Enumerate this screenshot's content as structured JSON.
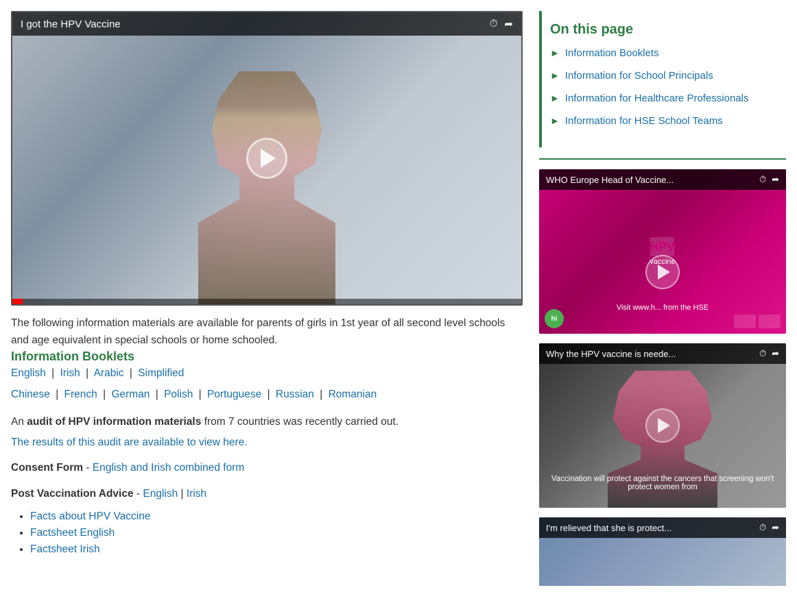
{
  "main_video": {
    "title": "I got the HPV Vaccine",
    "clock_icon": "⏱",
    "share_icon": "➦"
  },
  "description": "The following information materials are available for parents of girls in 1st year of all second level schools and age equivalent in special schools or home schooled.",
  "information_booklets": {
    "heading": "Information Booklets",
    "languages_row1": [
      {
        "label": "English",
        "href": "#"
      },
      {
        "label": "Irish",
        "href": "#"
      },
      {
        "label": "Arabic",
        "href": "#"
      },
      {
        "label": "Simplified",
        "href": "#"
      }
    ],
    "languages_row2": [
      {
        "label": "Chinese",
        "href": "#"
      },
      {
        "label": "French",
        "href": "#"
      },
      {
        "label": "German",
        "href": "#"
      },
      {
        "label": "Polish",
        "href": "#"
      },
      {
        "label": "Portuguese",
        "href": "#"
      },
      {
        "label": "Russian",
        "href": "#"
      },
      {
        "label": "Romanian",
        "href": "#"
      }
    ]
  },
  "audit": {
    "pre_text": "An",
    "bold_text": "audit of HPV information materials",
    "post_text": "from 7 countries was recently carried out.",
    "link_text": "The results of this audit are available to view here."
  },
  "consent_form": {
    "label": "Consent Form",
    "separator": "-",
    "link_text": "English and Irish combined form",
    "link_href": "#"
  },
  "post_vaccination": {
    "label": "Post Vaccination Advice",
    "separator": "-",
    "english_label": "English",
    "irish_label": "Irish",
    "english_href": "#",
    "irish_href": "#"
  },
  "bullet_links": [
    {
      "label": "Facts about HPV Vaccine",
      "href": "#"
    },
    {
      "label": "Factsheet English",
      "href": "#"
    },
    {
      "label": "Factsheet Irish",
      "href": "#"
    }
  ],
  "sidebar": {
    "on_this_page_title": "On this page",
    "items": [
      {
        "label": "Information Booklets",
        "href": "#"
      },
      {
        "label": "Information for School Principals",
        "href": "#"
      },
      {
        "label": "Information for  Healthcare Professionals",
        "href": "#"
      },
      {
        "label": "Information for HSE School Teams",
        "href": "#"
      }
    ],
    "videos": [
      {
        "title": "WHO Europe Head of Vaccine...",
        "style": "pink",
        "bottom_text_left": "HPV vaccine",
        "bottom_text_right": "Visit www.h... from the HSE"
      },
      {
        "title": "Why the HPV vaccine is neede...",
        "style": "dark",
        "bottom_text": "Vaccination will protect against the cancers that screening won't protect women from"
      },
      {
        "title": "I'm relieved that she is protect...",
        "style": "light",
        "bottom_text": ""
      }
    ]
  }
}
